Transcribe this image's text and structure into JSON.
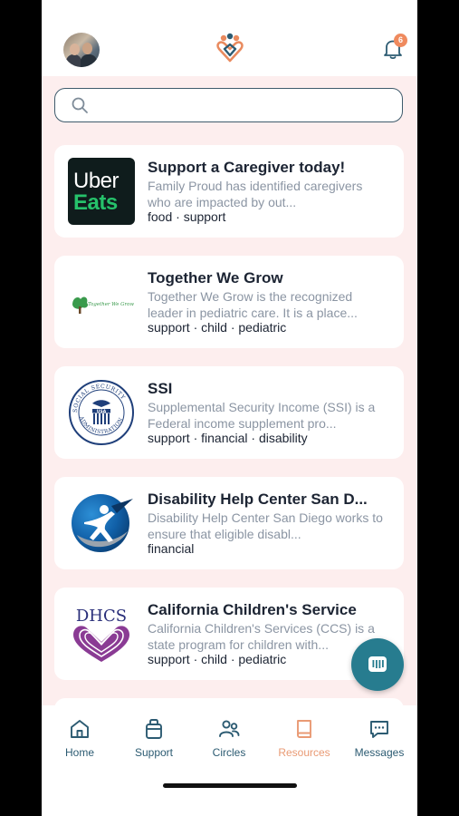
{
  "header": {
    "avatar": "user-avatar",
    "logo": "family-proud-logo",
    "notification_count": "6"
  },
  "search": {
    "placeholder": ""
  },
  "resources": [
    {
      "title": "Support a Caregiver today!",
      "description": "Family Proud has identified caregivers who are impacted by out...",
      "tags": "food · support",
      "logo": "uber-eats-logo",
      "logo_text_1": "Uber",
      "logo_text_2": "Eats"
    },
    {
      "title": "Together We Grow",
      "description": "Together We Grow is the recognized leader in pediatric care. It is a place...",
      "tags": "support · child · pediatric",
      "logo": "together-we-grow-logo",
      "logo_text": "Together We Grow"
    },
    {
      "title": "SSI",
      "description": "Supplemental Security Income (SSI) is a Federal income supplement pro...",
      "tags": "support · financial · disability",
      "logo": "social-security-administration-seal",
      "logo_text": "SOCIAL SECURITY ADMINISTRATION USA"
    },
    {
      "title": "Disability Help Center San D...",
      "description": "Disability Help Center San Diego works to ensure that eligible disabl...",
      "tags": "financial",
      "logo": "disability-help-center-logo"
    },
    {
      "title": "California Children's Service",
      "description": "California Children's Services (CCS) is a state program for children with...",
      "tags": "support · child · pediatric",
      "logo": "dhcs-logo",
      "logo_text": "DHCS"
    }
  ],
  "nav": [
    {
      "label": "Home",
      "icon": "home-icon"
    },
    {
      "label": "Support",
      "icon": "support-icon"
    },
    {
      "label": "Circles",
      "icon": "circles-icon"
    },
    {
      "label": "Resources",
      "icon": "resources-icon",
      "active": true
    },
    {
      "label": "Messages",
      "icon": "messages-icon"
    }
  ],
  "colors": {
    "accent": "#e99a74",
    "primary": "#2c5b72",
    "background": "#fdeeee",
    "fab": "#277c8f"
  }
}
